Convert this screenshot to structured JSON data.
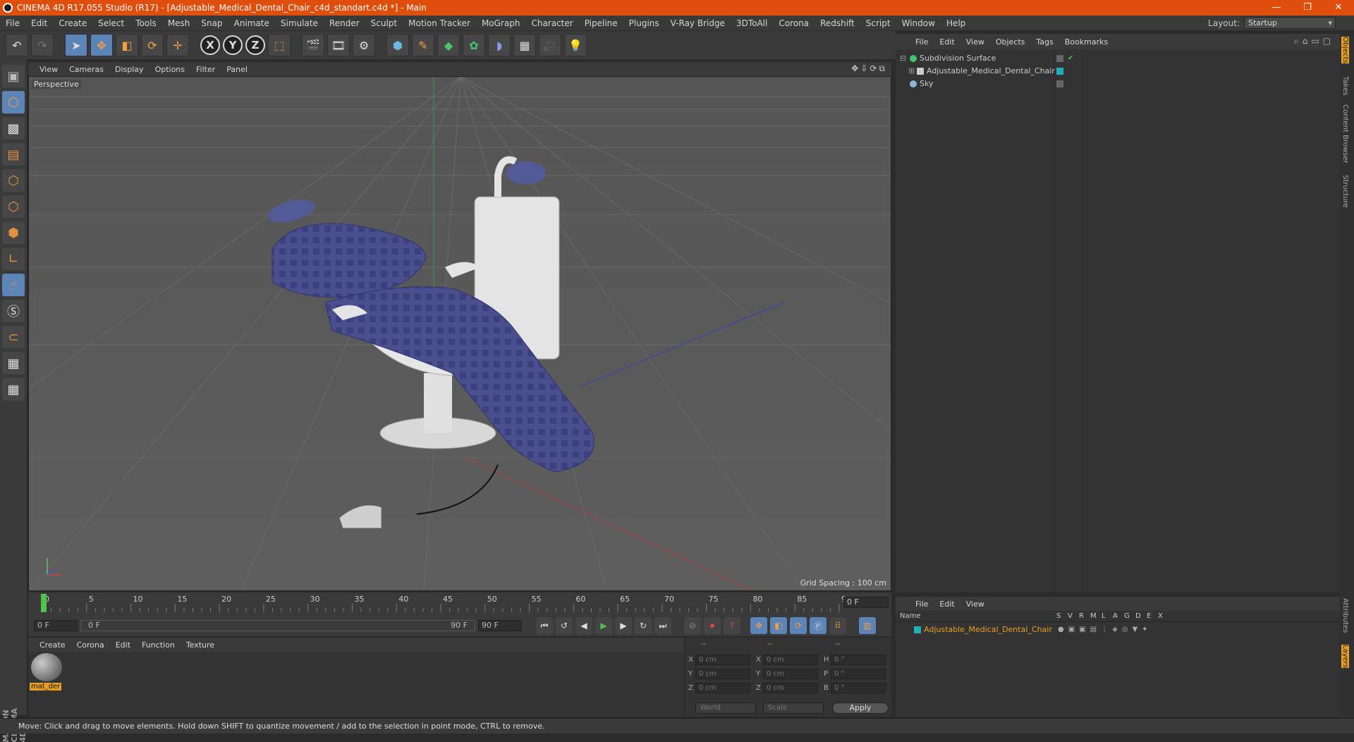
{
  "app": {
    "title": "CINEMA 4D R17.055 Studio (R17) - [Adjustable_Medical_Dental_Chair_c4d_standart.c4d *] - Main",
    "window_buttons": [
      "—",
      "❐",
      "✕"
    ]
  },
  "menubar": {
    "items": [
      "File",
      "Edit",
      "Create",
      "Select",
      "Tools",
      "Mesh",
      "Snap",
      "Animate",
      "Simulate",
      "Render",
      "Sculpt",
      "Motion Tracker",
      "MoGraph",
      "Character",
      "Pipeline",
      "Plugins",
      "V-Ray Bridge",
      "3DToAll",
      "Corona",
      "Redshift",
      "Script",
      "Window",
      "Help"
    ],
    "layout_label": "Layout:",
    "layout_value": "Startup"
  },
  "toolbar": {
    "axis_x": "X",
    "axis_y": "Y",
    "axis_z": "Z"
  },
  "viewport": {
    "menu": [
      "View",
      "Cameras",
      "Display",
      "Options",
      "Filter",
      "Panel"
    ],
    "camera_label": "Perspective",
    "grid_spacing": "Grid Spacing : 100 cm",
    "nav_icons": "✥⇩⟳⧉"
  },
  "timeline": {
    "ticks": [
      "0",
      "5",
      "10",
      "15",
      "20",
      "25",
      "30",
      "35",
      "40",
      "45",
      "50",
      "55",
      "60",
      "65",
      "70",
      "75",
      "80",
      "85",
      "90"
    ],
    "current_frame": "0 F",
    "start_field": "0 F",
    "range_start": "0 F",
    "range_end": "90 F",
    "end_field": "90 F"
  },
  "material_manager": {
    "menu": [
      "Create",
      "Corona",
      "Edit",
      "Function",
      "Texture"
    ],
    "material_name": "mat_der"
  },
  "coordinates": {
    "headers": [
      "--",
      "--",
      "--"
    ],
    "rows": [
      {
        "l1": "X",
        "v1": "0 cm",
        "l2": "X",
        "v2": "0 cm",
        "l3": "H",
        "v3": "0 °"
      },
      {
        "l1": "Y",
        "v1": "0 cm",
        "l2": "Y",
        "v2": "0 cm",
        "l3": "P",
        "v3": "0 °"
      },
      {
        "l1": "Z",
        "v1": "0 cm",
        "l2": "Z",
        "v2": "0 cm",
        "l3": "B",
        "v3": "0 °"
      }
    ],
    "mode_world": "World",
    "mode_scale": "Scale",
    "apply": "Apply"
  },
  "object_manager": {
    "menu": [
      "File",
      "Edit",
      "View",
      "Objects",
      "Tags",
      "Bookmarks"
    ],
    "objects": [
      {
        "name": "Subdivision Surface",
        "color": "#3ec46a"
      },
      {
        "name": "Adjustable_Medical_Dental_Chair",
        "color": "#cccccc"
      },
      {
        "name": "Sky",
        "color": "#8fb4d8"
      }
    ]
  },
  "layer_manager": {
    "menu": [
      "File",
      "Edit",
      "View"
    ],
    "columns": [
      "Name",
      "S",
      "V",
      "R",
      "M",
      "L",
      "A",
      "G",
      "D",
      "E",
      "X"
    ],
    "layer_name": "Adjustable_Medical_Dental_Chair",
    "layer_color": "#1fb0b8"
  },
  "right_tabs": [
    "Objects",
    "Takes",
    "Content Browser",
    "Structure",
    "Attributes",
    "Layers"
  ],
  "status": "Move: Click and drag to move elements. Hold down SHIFT to quantize movement / add to the selection in point mode, CTRL to remove.",
  "maxon": "MAXON CINEMA 4D",
  "colors": {
    "accent": "#e04e0e",
    "selected": "#5b84b8",
    "highlight": "#e8a020"
  }
}
